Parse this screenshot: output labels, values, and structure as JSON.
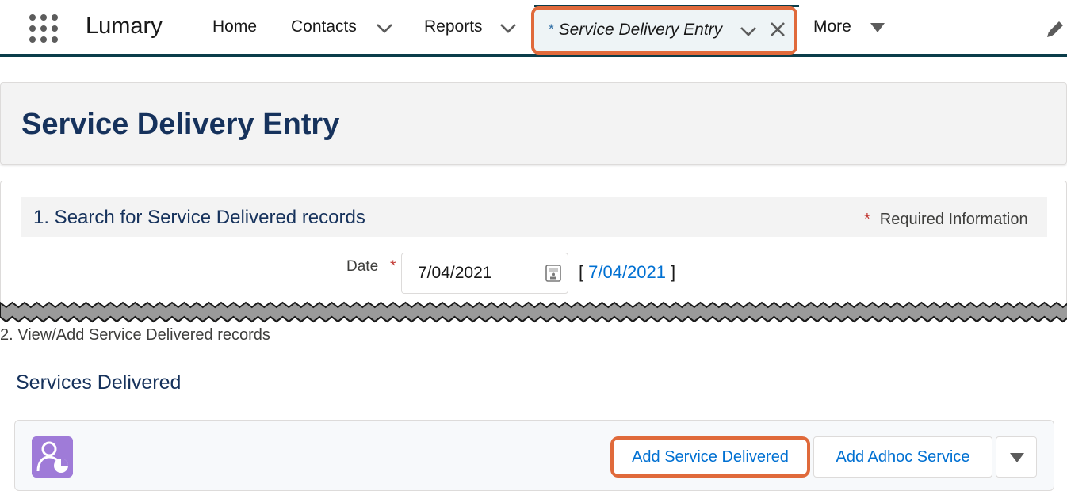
{
  "nav": {
    "app_name": "Lumary",
    "items": [
      {
        "label": "Home"
      },
      {
        "label": "Contacts"
      },
      {
        "label": "Reports"
      }
    ],
    "active_tab": {
      "modified_marker": "*",
      "label": "Service Delivery Entry"
    },
    "more_label": "More"
  },
  "header": {
    "title": "Service Delivery Entry"
  },
  "section1": {
    "title": "1. Search for Service Delivered records",
    "required_marker": "*",
    "required_text": "Required Information",
    "date_label": "Date",
    "date_required": "*",
    "date_value": "7/04/2021",
    "date_link": "7/04/2021",
    "bracket_open": "[",
    "bracket_close": "]"
  },
  "section2": {
    "label": "2. View/Add Service Delivered records",
    "list_title": "Services Delivered",
    "buttons": {
      "add_service_delivered": "Add Service Delivered",
      "add_adhoc_service": "Add Adhoc Service"
    }
  },
  "colors": {
    "highlight": "#e06a3b",
    "title_navy": "#16325c",
    "link_blue": "#0070d2",
    "nav_border": "#0b3d4a",
    "object_icon": "#9f7bd8"
  },
  "icons": [
    "app-launcher-icon",
    "chevron-down-icon",
    "close-icon",
    "caret-down-icon",
    "pencil-icon",
    "calendar-icon",
    "service-delivered-object-icon"
  ]
}
